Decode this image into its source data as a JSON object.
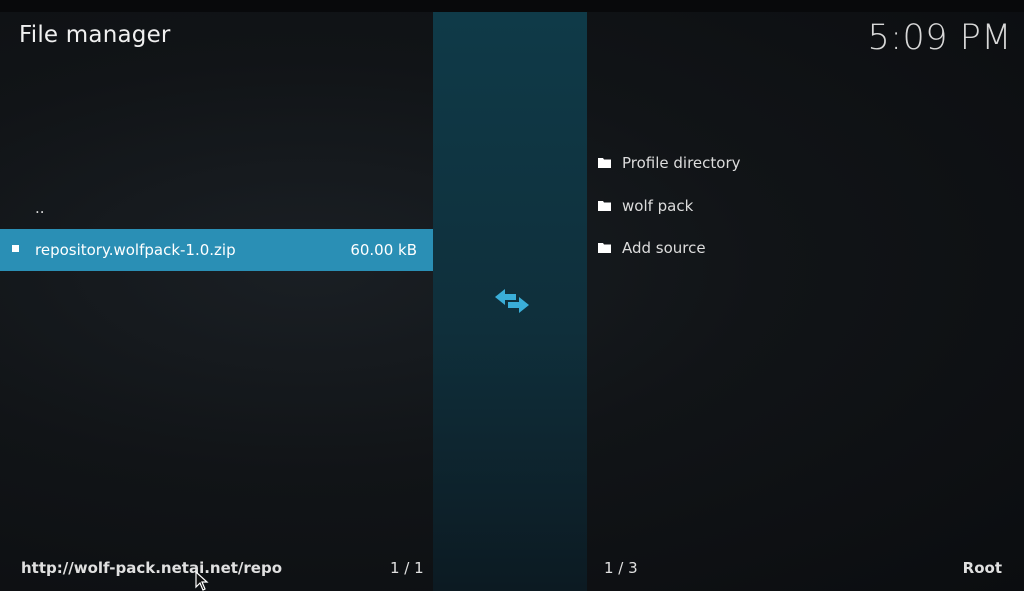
{
  "header": {
    "title": "File manager",
    "clock": "5:09 PM"
  },
  "left_pane": {
    "items": [
      {
        "name": ".."
      },
      {
        "name": "repository.wolfpack-1.0.zip",
        "size": "60.00 kB",
        "selected": true
      }
    ],
    "path": "http://wolf-pack.netai.net/repo",
    "page": "1 / 1"
  },
  "right_pane": {
    "items": [
      {
        "name": "Profile directory",
        "icon": "folder-icon"
      },
      {
        "name": "wolf pack",
        "icon": "folder-icon"
      },
      {
        "name": "Add source",
        "icon": "folder-icon"
      }
    ],
    "page": "1 / 3",
    "path": "Root"
  },
  "icons": {
    "swap": "swap-arrows-icon",
    "cursor": "mouse-cursor-icon"
  },
  "colors": {
    "accent": "#2a8fb5",
    "swap_icon": "#3aaed8",
    "divider": "#0f3a48"
  }
}
